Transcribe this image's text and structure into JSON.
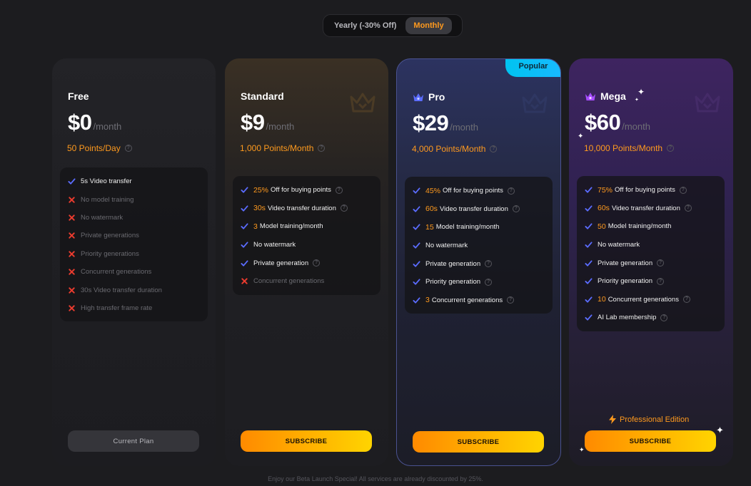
{
  "billing_toggle": {
    "yearly_label": "Yearly (-30% Off)",
    "monthly_label": "Monthly",
    "selected": "Monthly"
  },
  "colors": {
    "accent_orange": "#ff9a1e",
    "check_blue": "#5b6cff",
    "cross_red": "#e83b2e",
    "popular_cyan": "#18b9ff"
  },
  "plans": [
    {
      "name": "Free",
      "price": "$0",
      "period": "/month",
      "points": "50 Points/Day",
      "button": "Current Plan",
      "features": [
        {
          "highlight": "",
          "text": "5s Video transfer",
          "included": true,
          "help": false
        },
        {
          "highlight": "",
          "text": "No model training",
          "included": false,
          "help": false
        },
        {
          "highlight": "",
          "text": "No watermark",
          "included": false,
          "help": false
        },
        {
          "highlight": "",
          "text": "Private generations",
          "included": false,
          "help": false
        },
        {
          "highlight": "",
          "text": "Priority generations",
          "included": false,
          "help": false
        },
        {
          "highlight": "",
          "text": "Concurrent generations",
          "included": false,
          "help": false
        },
        {
          "highlight": "",
          "text": "30s Video transfer duration",
          "included": false,
          "help": false
        },
        {
          "highlight": "",
          "text": "High transfer frame rate",
          "included": false,
          "help": false
        }
      ]
    },
    {
      "name": "Standard",
      "price": "$9",
      "period": "/month",
      "points": "1,000 Points/Month",
      "button": "SUBSCRIBE",
      "features": [
        {
          "highlight": "25%",
          "text": "Off for buying points",
          "included": true,
          "help": true
        },
        {
          "highlight": "30s",
          "text": "Video transfer duration",
          "included": true,
          "help": true
        },
        {
          "highlight": "3",
          "text": "Model training/month",
          "included": true,
          "help": false
        },
        {
          "highlight": "",
          "text": "No watermark",
          "included": true,
          "help": false
        },
        {
          "highlight": "",
          "text": "Private generation",
          "included": true,
          "help": true
        },
        {
          "highlight": "",
          "text": "Concurrent generations",
          "included": false,
          "help": false
        }
      ]
    },
    {
      "name": "Pro",
      "badge": "Popular",
      "price": "$29",
      "period": "/month",
      "points": "4,000 Points/Month",
      "button": "SUBSCRIBE",
      "features": [
        {
          "highlight": "45%",
          "text": "Off for buying points",
          "included": true,
          "help": true
        },
        {
          "highlight": "60s",
          "text": "Video transfer duration",
          "included": true,
          "help": true
        },
        {
          "highlight": "15",
          "text": "Model training/month",
          "included": true,
          "help": false
        },
        {
          "highlight": "",
          "text": "No watermark",
          "included": true,
          "help": false
        },
        {
          "highlight": "",
          "text": "Private generation",
          "included": true,
          "help": true
        },
        {
          "highlight": "",
          "text": "Priority generation",
          "included": true,
          "help": true
        },
        {
          "highlight": "3",
          "text": "Concurrent generations",
          "included": true,
          "help": true
        }
      ]
    },
    {
      "name": "Mega",
      "price": "$60",
      "period": "/month",
      "points": "10,000 Points/Month",
      "edition_label": "Professional Edition",
      "button": "SUBSCRIBE",
      "features": [
        {
          "highlight": "75%",
          "text": "Off for buying points",
          "included": true,
          "help": true
        },
        {
          "highlight": "60s",
          "text": "Video transfer duration",
          "included": true,
          "help": true
        },
        {
          "highlight": "50",
          "text": "Model training/month",
          "included": true,
          "help": false
        },
        {
          "highlight": "",
          "text": "No watermark",
          "included": true,
          "help": false
        },
        {
          "highlight": "",
          "text": "Private generation",
          "included": true,
          "help": true
        },
        {
          "highlight": "",
          "text": "Priority generation",
          "included": true,
          "help": true
        },
        {
          "highlight": "10",
          "text": "Concurrent generations",
          "included": true,
          "help": true
        },
        {
          "highlight": "",
          "text": "AI Lab membership",
          "included": true,
          "help": true
        }
      ]
    }
  ],
  "footer_note": "Enjoy our Beta Launch Special! All services are already discounted by 25%."
}
